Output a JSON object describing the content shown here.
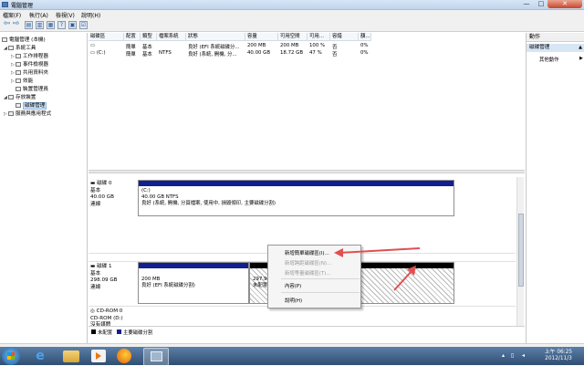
{
  "window": {
    "title": "電腦管理"
  },
  "menu": [
    "檔案(F)",
    "執行(A)",
    "檢視(V)",
    "說明(H)"
  ],
  "tree": [
    {
      "label": "電腦管理 (本機)",
      "level": 0,
      "expander": "",
      "selected": false
    },
    {
      "label": "系統工具",
      "level": 1,
      "expander": "◢",
      "selected": false
    },
    {
      "label": "工作排程器",
      "level": 2,
      "expander": "▷",
      "selected": false
    },
    {
      "label": "事件檢視器",
      "level": 2,
      "expander": "▷",
      "selected": false
    },
    {
      "label": "共用資料夾",
      "level": 2,
      "expander": "▷",
      "selected": false
    },
    {
      "label": "效能",
      "level": 2,
      "expander": "▷",
      "selected": false
    },
    {
      "label": "裝置管理員",
      "level": 2,
      "expander": "",
      "selected": false
    },
    {
      "label": "存放裝置",
      "level": 1,
      "expander": "◢",
      "selected": false
    },
    {
      "label": "磁碟管理",
      "level": 2,
      "expander": "",
      "selected": true
    },
    {
      "label": "服務與應用程式",
      "level": 1,
      "expander": "▷",
      "selected": false
    }
  ],
  "volume_table": {
    "headers": [
      "磁碟區",
      "配置",
      "類型",
      "檔案系統",
      "狀態",
      "容量",
      "可用空間",
      "可用...",
      "容錯",
      "額..."
    ],
    "rows": [
      [
        "",
        "簡單",
        "基本",
        "",
        "良好 (EFI 系統磁碟分...",
        "200 MB",
        "200 MB",
        "100 %",
        "否",
        "0%"
      ],
      [
        "(C:)",
        "簡單",
        "基本",
        "NTFS",
        "良好 (系統, 開機, 分...",
        "40.00 GB",
        "18.72 GB",
        "47 %",
        "否",
        "0%"
      ]
    ]
  },
  "disks": [
    {
      "info": [
        "磁碟 0",
        "基本",
        "40.00 GB",
        "連線"
      ],
      "partitions": [
        {
          "lines": [
            "(C:)",
            "40.00 GB NTFS",
            "良好 (系統, 開機, 分頁檔案, 使用中, 損毀傾印, 主要磁碟分割)"
          ],
          "style": "blue"
        }
      ]
    },
    {
      "info": [
        "磁碟 1",
        "基本",
        "298.09 GB",
        "連線"
      ],
      "partitions": [
        {
          "lines": [
            "",
            "200 MB",
            "良好 (EFI 系統磁碟分割)"
          ],
          "style": "blue"
        },
        {
          "lines": [
            "",
            "297.90 GB",
            "未配置"
          ],
          "style": "unallocated"
        }
      ]
    },
    {
      "info": [
        "CD-ROM 0",
        "CD-ROM (D:)",
        "",
        "沒有媒體"
      ],
      "partitions": []
    }
  ],
  "legend": [
    {
      "label": "未配置",
      "color": "#000000"
    },
    {
      "label": "主要磁碟分割",
      "color": "#11208e"
    }
  ],
  "context_menu": [
    {
      "label": "新增簡單磁碟區(I)...",
      "enabled": true
    },
    {
      "label": "新增跨距磁碟區(N)...",
      "enabled": false
    },
    {
      "label": "新增等量磁碟區(T)...",
      "enabled": false
    },
    {
      "separator": true
    },
    {
      "label": "內容(P)",
      "enabled": true
    },
    {
      "separator": true
    },
    {
      "label": "說明(H)",
      "enabled": true
    }
  ],
  "actions": {
    "header": "動作",
    "section": "磁碟管理",
    "more": "其他動作"
  },
  "clock": {
    "time": "上午 06:25",
    "date": "2012/11/3"
  },
  "colors": {
    "accent_arrow": "#e05050",
    "partition_blue": "#11208e"
  }
}
